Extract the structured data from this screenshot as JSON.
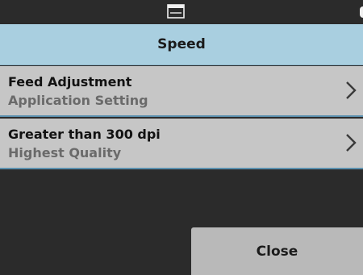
{
  "status_bar": {
    "icons": [
      "scanner-icon",
      "status-indicator-icon"
    ]
  },
  "header": {
    "title": "Speed"
  },
  "items": [
    {
      "title": "Feed Adjustment",
      "subtitle": "Application Setting",
      "icon": "chevron-right-icon"
    },
    {
      "title": "Greater than 300 dpi",
      "subtitle": "Highest Quality",
      "icon": "chevron-right-icon"
    }
  ],
  "footer": {
    "close_label": "Close"
  },
  "colors": {
    "background": "#2b2b2b",
    "header": "#a9cfe0",
    "item": "#c6c6c6",
    "item_divider": "#5a8fae",
    "button": "#b9b9b9"
  }
}
